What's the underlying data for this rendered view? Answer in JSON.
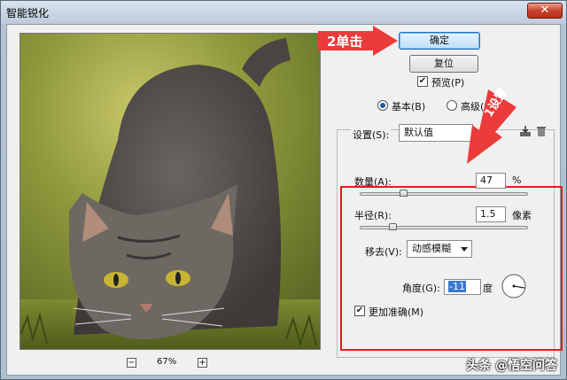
{
  "window": {
    "title": "智能锐化",
    "close": "✕"
  },
  "annotations": {
    "step2": "2单击",
    "step1": "1设置"
  },
  "buttons": {
    "ok": "确定",
    "reset": "复位"
  },
  "preview_check": {
    "label": "预览(P)",
    "checked": true
  },
  "mode": {
    "basic": "基本(B)",
    "advanced": "高级(D)",
    "selected": "basic"
  },
  "settings": {
    "label": "设置(S):",
    "value": "默认值"
  },
  "amount": {
    "label": "数量(A):",
    "value": "47",
    "unit": "%",
    "fraction": 0.47
  },
  "radius": {
    "label": "半径(R):",
    "value": "1.5",
    "unit": "像素",
    "fraction": 0.18
  },
  "remove": {
    "label": "移去(V):",
    "value": "动感模糊"
  },
  "angle": {
    "label": "角度(G):",
    "value": "-11",
    "unit": "度"
  },
  "more_accurate": {
    "label": "更加准确(M)",
    "checked": true
  },
  "zoom": {
    "value": "67%",
    "minus": "−",
    "plus": "+"
  },
  "watermark": "头条 @悟空问答",
  "colors": {
    "accent": "#e11e1e",
    "focus": "#2b70b8"
  }
}
